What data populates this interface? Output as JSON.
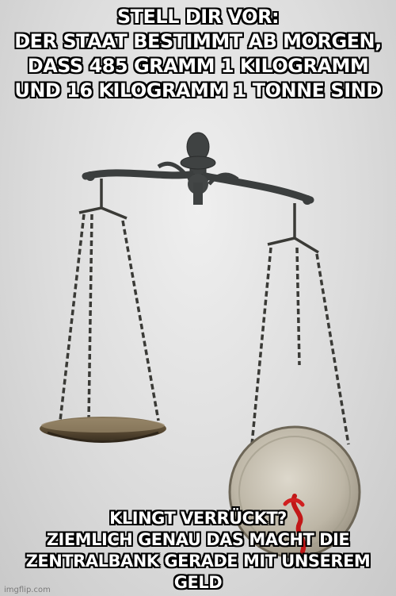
{
  "meme": {
    "top_lines": [
      "STELL DIR VOR:",
      "DER STAAT BESTIMMT AB MORGEN,",
      "DASS 485 GRAMM 1 KILOGRAMM",
      "UND 16 KILOGRAMM 1 TONNE SIND"
    ],
    "bottom_lines": [
      "KLINGT VERRÜCKT?",
      "ZIEMLICH GENAU DAS MACHT DIE",
      "ZENTRALBANK GERADE MIT UNSEREM GELD"
    ],
    "watermark": "imgflip.com"
  }
}
